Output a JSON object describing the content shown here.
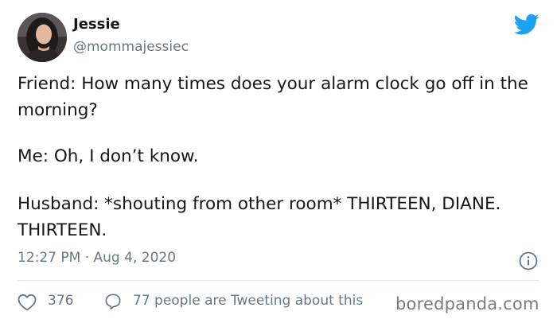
{
  "tweet": {
    "display_name": "Jessie",
    "handle": "@mommajessiec",
    "paragraphs": [
      "Friend: How many times does your alarm clock go off in the morning?",
      "Me: Oh, I don’t know.",
      "Husband: *shouting from other room* THIRTEEN, DIANE. THIRTEEN."
    ],
    "timestamp": "12:27 PM · Aug 4, 2020",
    "likes": "376",
    "replies_text": "77 people are Tweeting about this"
  },
  "watermark": "boredpanda.com",
  "colors": {
    "twitter_blue": "#1da1f2",
    "secondary_text": "#657786",
    "primary_text": "#14171a"
  },
  "icons": {
    "brand": "twitter-bird-icon",
    "info": "info-icon",
    "like": "heart-icon",
    "reply": "speech-bubble-icon"
  }
}
